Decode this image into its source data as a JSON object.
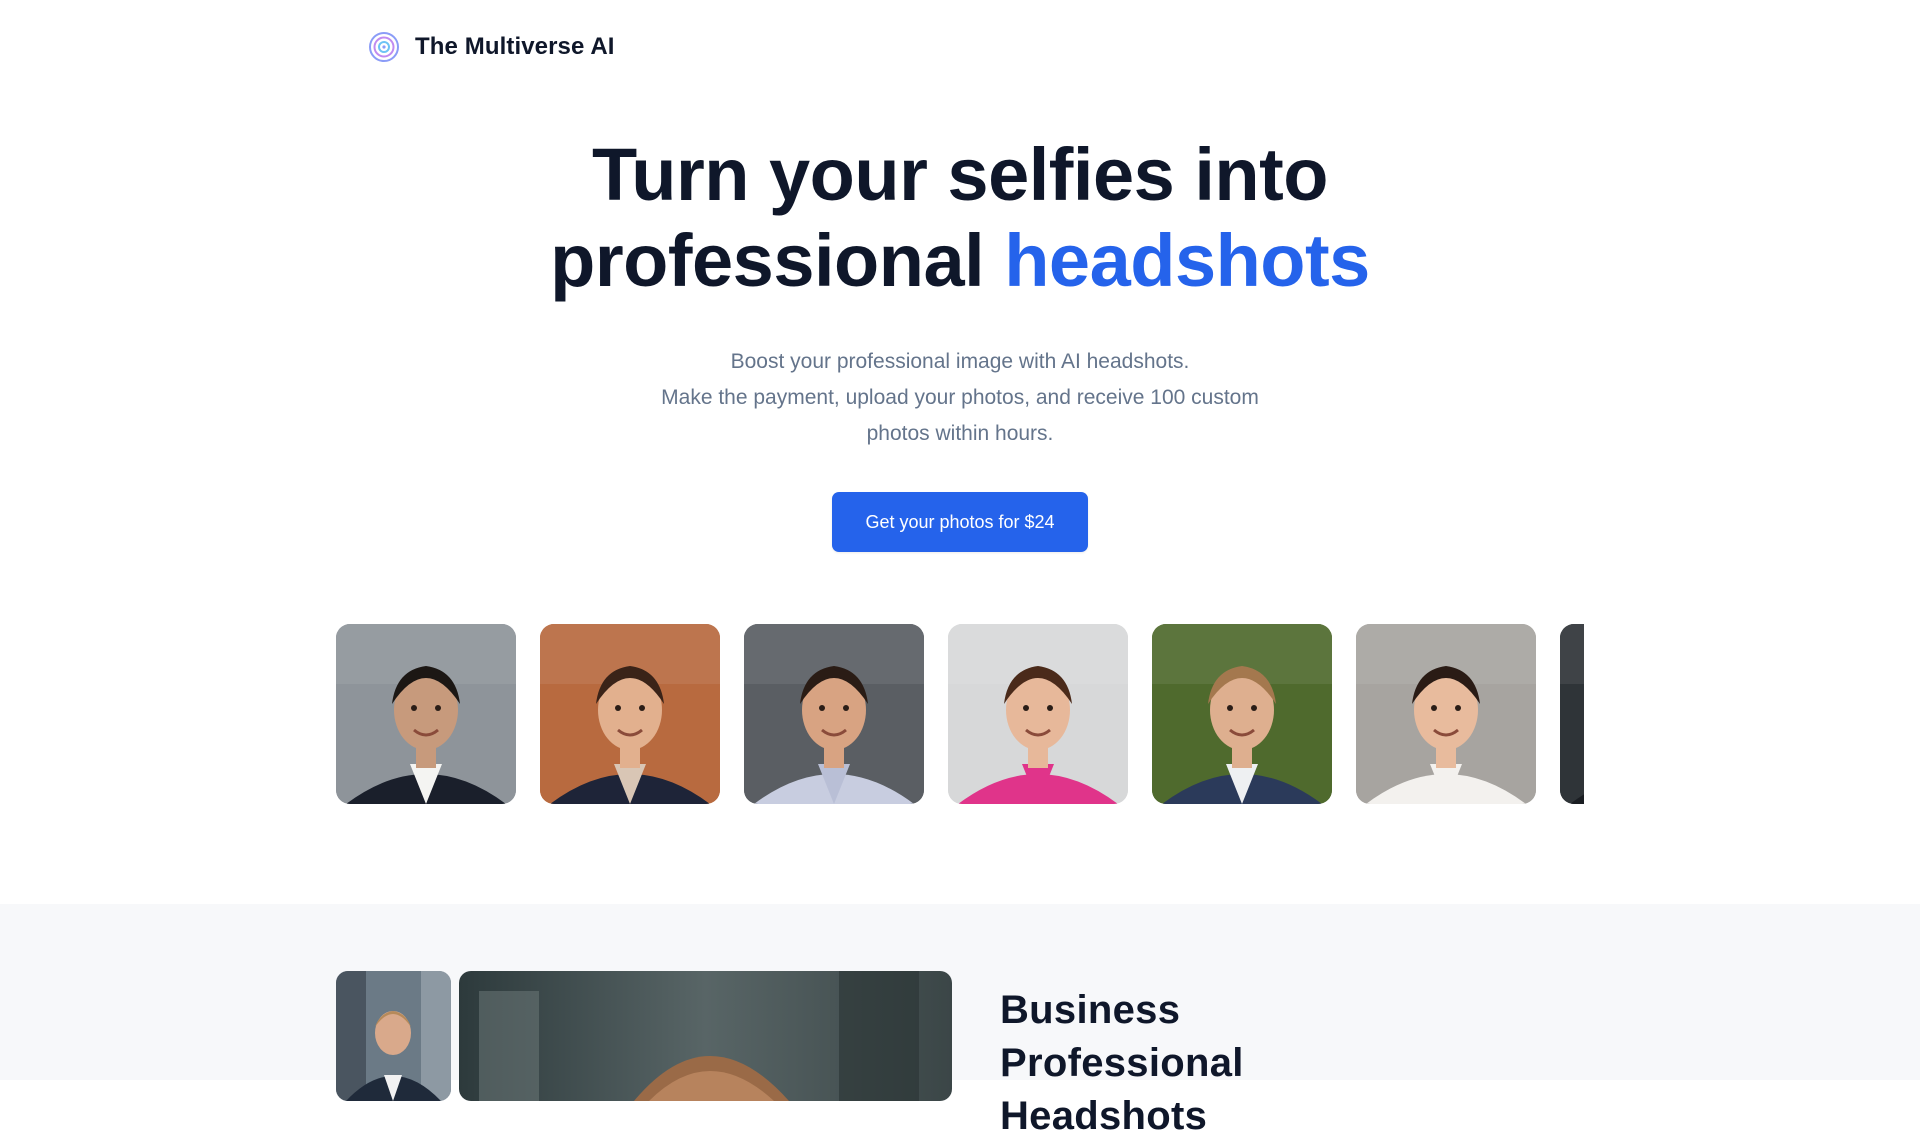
{
  "brand": {
    "name": "The Multiverse AI",
    "icon": "multiverse-logo-icon",
    "colors": {
      "ring1": "#8b9cf7",
      "ring2": "#c08bf0",
      "ring3": "#6ec3f5"
    }
  },
  "hero": {
    "title_line1": "Turn your selfies into",
    "title_line2_prefix": "professional",
    "title_line2_accent": "headshots",
    "subtitle_line1": "Boost your professional image with AI headshots.",
    "subtitle_line2": "Make the payment, upload your photos, and receive 100 custom",
    "subtitle_line3": "photos within hours.",
    "cta_label": "Get your photos for $24"
  },
  "gallery": {
    "items": [
      {
        "name": "headshot-photo-man-beard-suit",
        "bg": "#8e949a",
        "skin": "#c79a7c",
        "hair": "#1c1714",
        "clothes": "#1a1f2b",
        "shirt": "#f4f4f2"
      },
      {
        "name": "headshot-photo-woman-long-hair",
        "bg": "#b86a3f",
        "skin": "#e2b08e",
        "hair": "#3a2318",
        "clothes": "#1e2438",
        "shirt": "#d9c6b5"
      },
      {
        "name": "headshot-photo-young-man-smiling",
        "bg": "#5a5e63",
        "skin": "#d8a382",
        "hair": "#2a1c15",
        "clothes": "#c8cde0",
        "shirt": "#b9bfd6"
      },
      {
        "name": "headshot-photo-woman-bangs",
        "bg": "#d7d8d9",
        "skin": "#e7b89a",
        "hair": "#4a2a1a",
        "clothes": "#e0348a",
        "shirt": "#e0348a"
      },
      {
        "name": "headshot-photo-man-blond-suit",
        "bg": "#4f6a2d",
        "skin": "#deaf8f",
        "hair": "#a4784e",
        "clothes": "#2b3a5a",
        "shirt": "#eef0f2"
      },
      {
        "name": "headshot-photo-woman-white-blouse",
        "bg": "#a7a4a0",
        "skin": "#e8bb9d",
        "hair": "#2a1b15",
        "clothes": "#f3f1ee",
        "shirt": "#f3f1ee"
      },
      {
        "name": "headshot-photo-partial",
        "bg": "#2f3438",
        "skin": "#c99b7a",
        "hair": "#111111",
        "clothes": "#1a1d22",
        "shirt": "#2c3035"
      }
    ]
  },
  "section2": {
    "title_line1": "Business Professional",
    "title_line2": "Headshots",
    "small_photo": "business-headshot-thumbnail",
    "large_photo": "business-headshot-large"
  }
}
